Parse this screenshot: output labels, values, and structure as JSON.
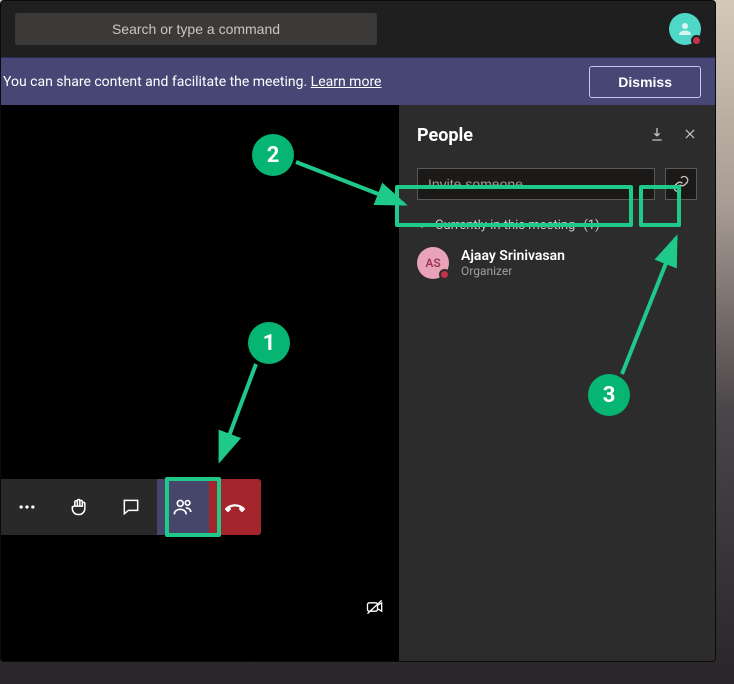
{
  "topbar": {
    "search_placeholder": "Search or type a command"
  },
  "banner": {
    "text": "You can share content and facilitate the meeting. ",
    "link_text": "Learn more",
    "dismiss_label": "Dismiss"
  },
  "people_panel": {
    "title": "People",
    "invite_placeholder": "Invite someone",
    "section_label": "Currently in this meeting",
    "section_count": "(1)",
    "participants": [
      {
        "initials": "AS",
        "name": "Ajaay Srinivasan",
        "role": "Organizer"
      }
    ]
  },
  "callouts": {
    "one": "1",
    "two": "2",
    "three": "3"
  }
}
